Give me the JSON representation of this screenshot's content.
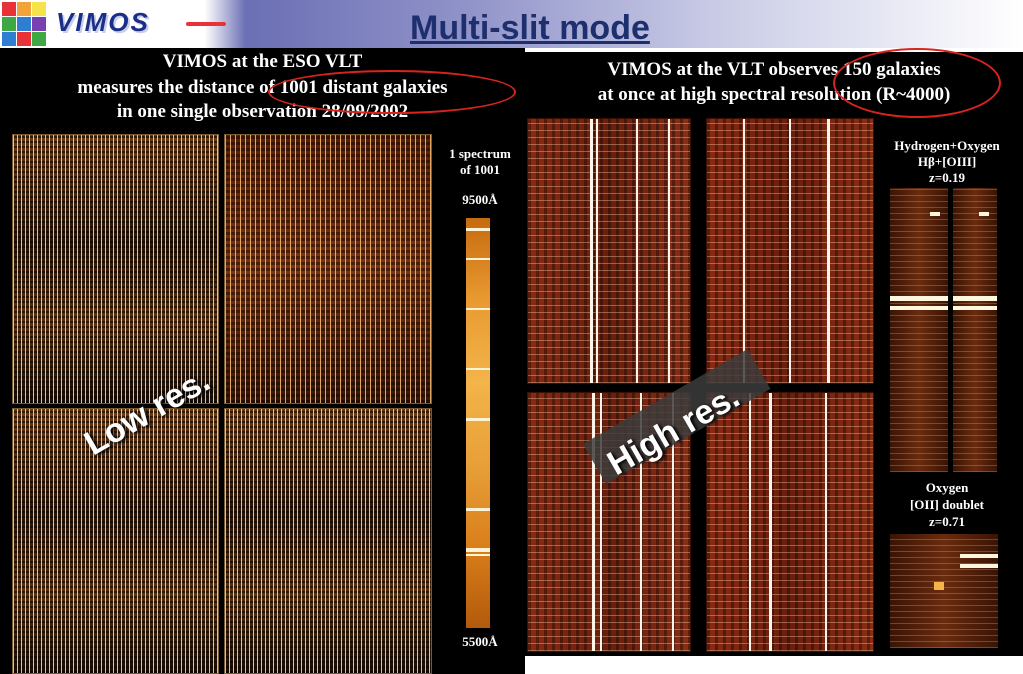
{
  "header": {
    "logo_text": "VIMOS",
    "title": "Multi-slit mode"
  },
  "left": {
    "caption_line1": "VIMOS at the ESO VLT",
    "caption_line2": "measures the distance of 1001 distant galaxies",
    "caption_line3": "in one single observation 28/09/2002",
    "overlay_label": "Low res.",
    "spectrum_label_line1": "1 spectrum",
    "spectrum_label_line2": "of 1001",
    "wavelength_top": "9500Å",
    "wavelength_bottom": "5500Å"
  },
  "right": {
    "caption_line1": "VIMOS at the VLT observes 150 galaxies",
    "caption_line2": "at once at high spectral resolution (R~4000)",
    "overlay_label": "High res.",
    "h_label_line1": "Hydrogen+Oxygen",
    "h_label_line2": "Hβ+[OIII]",
    "h_label_line3": "z=0.19",
    "o_label_line1": "Oxygen",
    "o_label_line2": "[OII] doublet",
    "o_label_line3": "z=0.71"
  },
  "colors": {
    "title": "#1d2f6d",
    "circle": "#d9231e",
    "panel_bg": "#000000"
  }
}
